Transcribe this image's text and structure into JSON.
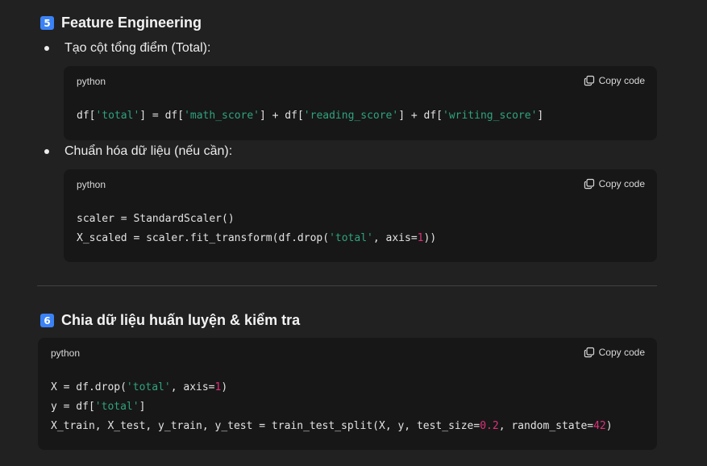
{
  "section5": {
    "badge": "5",
    "title": "Feature Engineering",
    "items": [
      {
        "text": "Tạo cột tổng điểm (Total):",
        "code": {
          "language": "python",
          "copy_label": "Copy code",
          "lines": [
            [
              {
                "t": "df[",
                "k": "plain"
              },
              {
                "t": "'total'",
                "k": "str"
              },
              {
                "t": "] = df[",
                "k": "plain"
              },
              {
                "t": "'math_score'",
                "k": "str"
              },
              {
                "t": "] + df[",
                "k": "plain"
              },
              {
                "t": "'reading_score'",
                "k": "str"
              },
              {
                "t": "] + df[",
                "k": "plain"
              },
              {
                "t": "'writing_score'",
                "k": "str"
              },
              {
                "t": "]",
                "k": "plain"
              }
            ]
          ]
        }
      },
      {
        "text": "Chuẩn hóa dữ liệu (nếu cần):",
        "code": {
          "language": "python",
          "copy_label": "Copy code",
          "lines": [
            [
              {
                "t": "scaler = StandardScaler()",
                "k": "plain"
              }
            ],
            [
              {
                "t": "X_scaled = scaler.fit_transform(df.drop(",
                "k": "plain"
              },
              {
                "t": "'total'",
                "k": "str"
              },
              {
                "t": ", axis=",
                "k": "plain"
              },
              {
                "t": "1",
                "k": "num"
              },
              {
                "t": "))",
                "k": "plain"
              }
            ]
          ]
        }
      }
    ]
  },
  "section6": {
    "badge": "6",
    "title": "Chia dữ liệu huấn luyện & kiểm tra",
    "code": {
      "language": "python",
      "copy_label": "Copy code",
      "lines": [
        [
          {
            "t": "X = df.drop(",
            "k": "plain"
          },
          {
            "t": "'total'",
            "k": "str"
          },
          {
            "t": ", axis=",
            "k": "plain"
          },
          {
            "t": "1",
            "k": "num"
          },
          {
            "t": ")",
            "k": "plain"
          }
        ],
        [
          {
            "t": "y = df[",
            "k": "plain"
          },
          {
            "t": "'total'",
            "k": "str"
          },
          {
            "t": "]",
            "k": "plain"
          }
        ],
        [
          {
            "t": "X_train, X_test, y_train, y_test = train_test_split(X, y, test_size=",
            "k": "plain"
          },
          {
            "t": "0.2",
            "k": "num"
          },
          {
            "t": ", random_state=",
            "k": "plain"
          },
          {
            "t": "42",
            "k": "num"
          },
          {
            "t": ")",
            "k": "plain"
          }
        ]
      ]
    }
  },
  "colors": {
    "string": "#2fa37f",
    "number": "#df3079",
    "badge": "#3b82f6",
    "code_bg": "#171717",
    "page_bg": "#212121"
  },
  "icons": {
    "copy": "copy-icon",
    "badge": "keycap-number-icon",
    "bullet": "bullet-dot"
  }
}
